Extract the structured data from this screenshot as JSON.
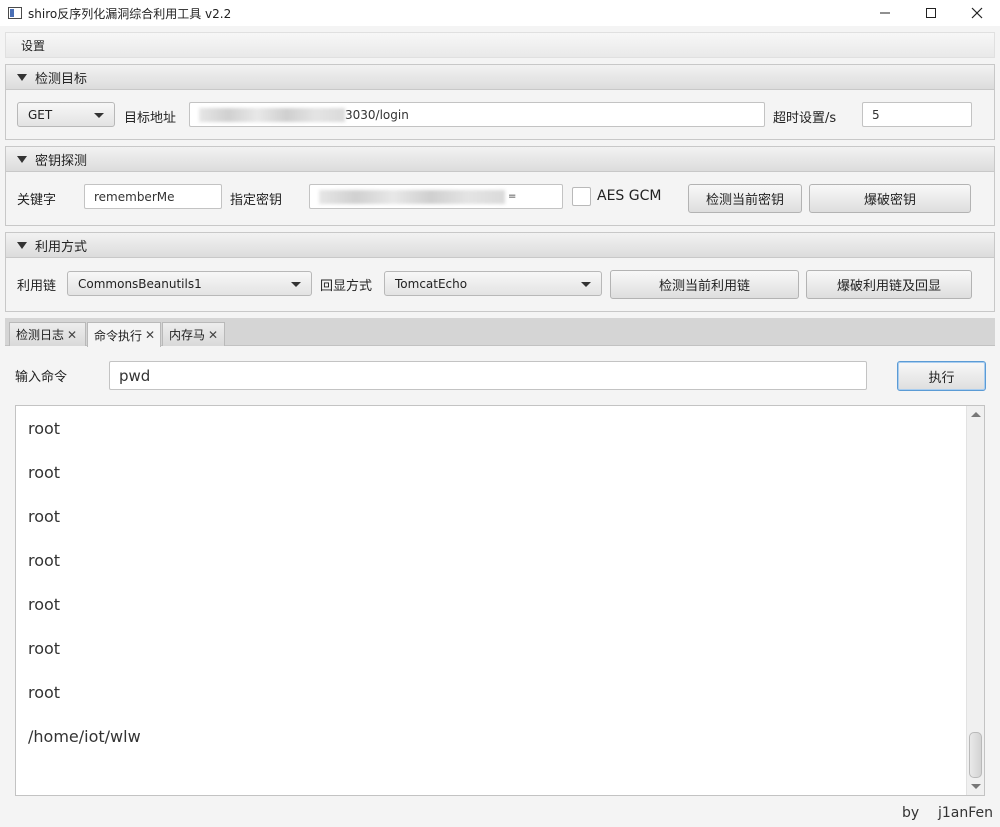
{
  "window": {
    "title": "shiro反序列化漏洞综合利用工具 v2.2"
  },
  "menu": {
    "settings": "设置"
  },
  "detect_target": {
    "header": "检测目标",
    "method": "GET",
    "url_label": "目标地址",
    "url_value_visible": "3030/login",
    "timeout_label": "超时设置/s",
    "timeout_value": "5"
  },
  "key_detect": {
    "header": "密钥探测",
    "keyword_label": "关键字",
    "keyword_value": "rememberMe",
    "key_label": "指定密钥",
    "key_value_visible": "=",
    "aes_gcm_label": "AES GCM",
    "aes_gcm_checked": false,
    "check_key_button": "检测当前密钥",
    "brute_key_button": "爆破密钥"
  },
  "exploit": {
    "header": "利用方式",
    "chain_label": "利用链",
    "chain_value": "CommonsBeanutils1",
    "echo_label": "回显方式",
    "echo_value": "TomcatEcho",
    "check_chain_button": "检测当前利用链",
    "brute_chain_button": "爆破利用链及回显"
  },
  "tabs": [
    {
      "label": "检测日志",
      "active": false
    },
    {
      "label": "命令执行",
      "active": true
    },
    {
      "label": "内存马",
      "active": false
    }
  ],
  "tab_close_glyph": "✕",
  "command": {
    "label": "输入命令",
    "value": "pwd",
    "execute_button": "执行"
  },
  "output_lines": [
    "root",
    "root",
    "root",
    "root",
    "root",
    "root",
    "root",
    "/home/iot/wlw"
  ],
  "footer": {
    "by": "by",
    "author": "j1anFen"
  }
}
